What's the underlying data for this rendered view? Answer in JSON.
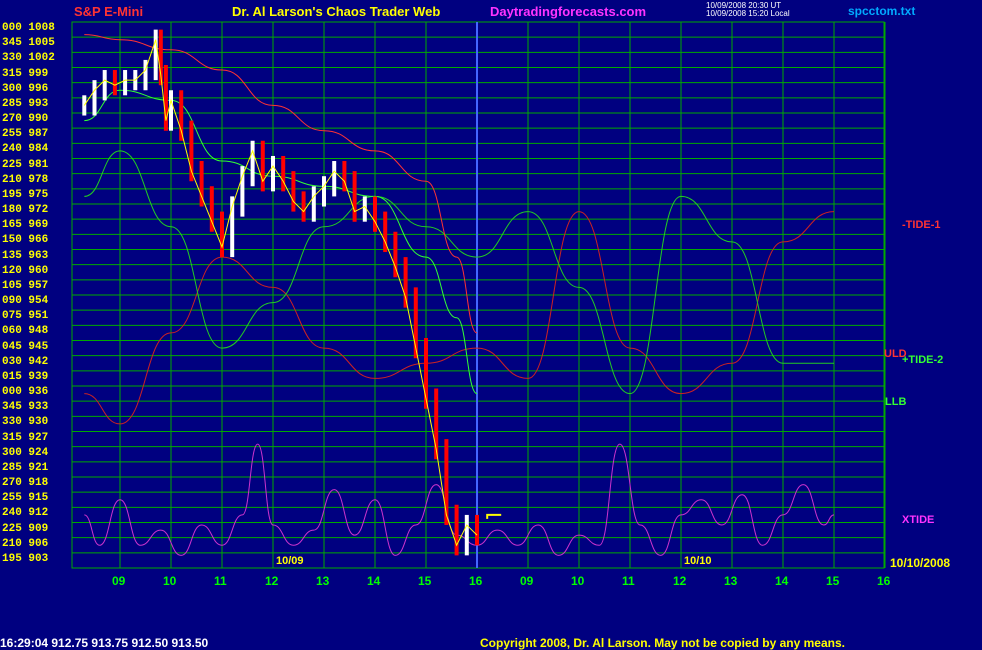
{
  "header": {
    "instrument": "S&P E-Mini",
    "title": "Dr. Al Larson's Chaos Trader Web",
    "site": "Daytradingforecasts.com",
    "stamp_line1": "10/09/2008 20:30 UT",
    "stamp_line2": "10/09/2008 15:20 Local",
    "file": "spcctom.txt"
  },
  "footer": {
    "quote": "16:29:04  912.75 913.75 912.50 913.50",
    "copyright": "Copyright 2008, Dr. Al Larson. May not be copied by any means."
  },
  "colors": {
    "background": "#000080",
    "grid": "#00aa00",
    "price_down": "#ff0000",
    "price_up": "#ffffff",
    "yellow": "#ffff00",
    "tide1": "#cc2222",
    "tide2": "#22cc22",
    "xtide": "#cc33cc",
    "uld": "#ff3333",
    "llb": "#33ff33"
  },
  "chart_data": {
    "type": "line",
    "title": "S&P E-Mini",
    "y_tick_labels": [
      "000 1008",
      "345 1005",
      "330 1002",
      "315 999",
      "300 996",
      "285 993",
      "270 990",
      "255 987",
      "240 984",
      "225 981",
      "210 978",
      "195 975",
      "180 972",
      "165 969",
      "150 966",
      "135 963",
      "120 960",
      "105 957",
      "090 954",
      "075 951",
      "060 948",
      "045 945",
      "030 942",
      "015 939",
      "000 936",
      "345 933",
      "330 930",
      "315 927",
      "300 924",
      "285 921",
      "270 918",
      "255 915",
      "240 912",
      "225 909",
      "210 906",
      "195 903"
    ],
    "ylim": [
      903,
      1008
    ],
    "x_tick_labels": [
      "09",
      "10",
      "11",
      "12",
      "13",
      "14",
      "15",
      "16",
      "09",
      "10",
      "11",
      "12",
      "13",
      "14",
      "15",
      "16"
    ],
    "date_labels": [
      "10/09",
      "10/10",
      "10/10/2008"
    ],
    "right_labels": {
      "tide1": "-TIDE-1",
      "uld": "ULD",
      "tide2": "+TIDE-2",
      "llb": "LLB",
      "xtide": "XTIDE"
    },
    "price": {
      "name": "S&P E-Mini",
      "x_hours": [
        8.3,
        8.5,
        8.7,
        8.9,
        9.1,
        9.3,
        9.5,
        9.7,
        9.8,
        9.9,
        10.0,
        10.2,
        10.4,
        10.6,
        10.8,
        11.0,
        11.2,
        11.4,
        11.6,
        11.8,
        12.0,
        12.2,
        12.4,
        12.6,
        12.8,
        13.0,
        13.2,
        13.4,
        13.6,
        13.8,
        14.0,
        14.2,
        14.4,
        14.6,
        14.8,
        15.0,
        15.2,
        15.4,
        15.6,
        15.8,
        16.0
      ],
      "y": [
        993,
        996,
        998,
        997,
        998,
        998,
        1000,
        1006,
        999,
        990,
        994,
        988,
        980,
        975,
        970,
        965,
        973,
        979,
        984,
        978,
        981,
        978,
        974,
        972,
        975,
        977,
        980,
        978,
        972,
        973,
        970,
        966,
        961,
        955,
        945,
        935,
        925,
        912,
        906,
        910,
        908
      ]
    },
    "series": [
      {
        "name": "-TIDE-1",
        "x_hours": [
          8.3,
          9.0,
          10.0,
          11.0,
          12.0,
          13.0,
          14.0,
          15.0,
          16.0,
          17.0,
          18.0,
          19.0,
          20.0,
          21.0,
          22.0,
          23.0
        ],
        "y": [
          936,
          930,
          948,
          963,
          957,
          945,
          939,
          942,
          945,
          939,
          972,
          945,
          936,
          942,
          966,
          972
        ]
      },
      {
        "name": "+TIDE-2",
        "x_hours": [
          8.3,
          9.0,
          10.0,
          11.0,
          12.0,
          13.0,
          14.0,
          15.0,
          16.0,
          17.0,
          18.0,
          19.0,
          20.0,
          21.0,
          22.0,
          23.0
        ],
        "y": [
          975,
          984,
          969,
          945,
          954,
          969,
          975,
          969,
          963,
          972,
          957,
          936,
          975,
          966,
          942,
          942
        ]
      },
      {
        "name": "XTIDE",
        "x_hours": [
          8.3,
          8.6,
          9.0,
          9.4,
          9.8,
          10.2,
          10.6,
          11.0,
          11.4,
          11.7,
          12.0,
          12.4,
          12.8,
          13.2,
          13.6,
          14.0,
          14.4,
          14.8,
          15.2,
          15.6,
          16.0,
          16.4,
          16.8,
          17.2,
          17.6,
          18.0,
          18.4,
          18.8,
          19.2,
          19.6,
          20.0,
          20.4,
          20.8,
          21.2,
          21.6,
          22.0,
          22.4,
          22.8,
          23.0
        ],
        "y": [
          912,
          906,
          915,
          906,
          909,
          904,
          910,
          906,
          912,
          926,
          910,
          906,
          909,
          917,
          908,
          915,
          904,
          910,
          918,
          908,
          906,
          909,
          906,
          910,
          904,
          908,
          906,
          926,
          910,
          904,
          912,
          915,
          910,
          916,
          906,
          912,
          918,
          910,
          912
        ]
      },
      {
        "name": "ULD",
        "x_hours": [
          8.3,
          9.0,
          10.0,
          11.0,
          12.0,
          13.0,
          14.0,
          15.0,
          15.6,
          16.0
        ],
        "y": [
          1007,
          1006,
          1004,
          1000,
          993,
          988,
          984,
          978,
          963,
          948
        ]
      },
      {
        "name": "LLB",
        "x_hours": [
          8.3,
          9.0,
          10.0,
          11.0,
          12.0,
          13.0,
          14.0,
          15.0,
          15.6,
          16.0
        ],
        "y": [
          990,
          996,
          994,
          982,
          979,
          977,
          975,
          963,
          951,
          936
        ]
      }
    ]
  }
}
